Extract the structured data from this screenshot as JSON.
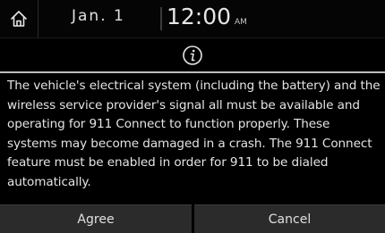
{
  "status_bar": {
    "home_icon": "home-icon",
    "date": "Jan.  1",
    "time": "12:00",
    "ampm": "AM"
  },
  "dialog": {
    "header_icon": "info-icon",
    "message": "The vehicle's electrical system (including the battery) and the wireless service provider's signal all must be available and operating for 911 Connect to function properly. These systems may become damaged in a crash. The 911 Connect feature must be enabled in order for 911 to be dialed automatically.",
    "agree_label": "Agree",
    "cancel_label": "Cancel"
  },
  "colors": {
    "background": "#000000",
    "button_bg": "#2b2b2b",
    "text": "#e4e4e4",
    "divider": "#bdbdbd"
  }
}
